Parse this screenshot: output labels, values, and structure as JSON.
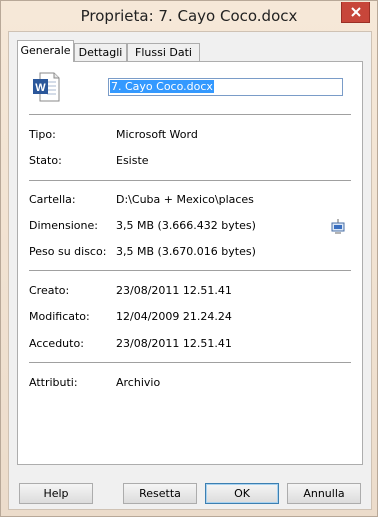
{
  "window": {
    "title": "Proprieta: 7. Cayo Coco.docx"
  },
  "tabs": [
    {
      "label": "Generale"
    },
    {
      "label": "Dettagli"
    },
    {
      "label": "Flussi Dati"
    }
  ],
  "file": {
    "name": "7. Cayo Coco.docx",
    "icon": "word-document-icon"
  },
  "properties": {
    "tipo": {
      "label": "Tipo:",
      "value": "Microsoft Word"
    },
    "stato": {
      "label": "Stato:",
      "value": "Esiste"
    },
    "cartella": {
      "label": "Cartella:",
      "value": "D:\\Cuba + Mexico\\places"
    },
    "dimensione": {
      "label": "Dimensione:",
      "value": "3,5 MB (3.666.432 bytes)"
    },
    "peso": {
      "label": "Peso su disco:",
      "value": "3,5 MB (3.670.016 bytes)"
    },
    "creato": {
      "label": "Creato:",
      "value": "23/08/2011 12.51.41"
    },
    "modificato": {
      "label": "Modificato:",
      "value": "12/04/2009 21.24.24"
    },
    "acceduto": {
      "label": "Acceduto:",
      "value": "23/08/2011 12.51.41"
    },
    "attributi": {
      "label": "Attributi:",
      "value": "Archivio"
    }
  },
  "buttons": {
    "help": "Help",
    "reset": "Resetta",
    "ok": "OK",
    "cancel": "Annulla"
  },
  "colors": {
    "close_button": "#c7463a",
    "selection": "#3399ff"
  }
}
